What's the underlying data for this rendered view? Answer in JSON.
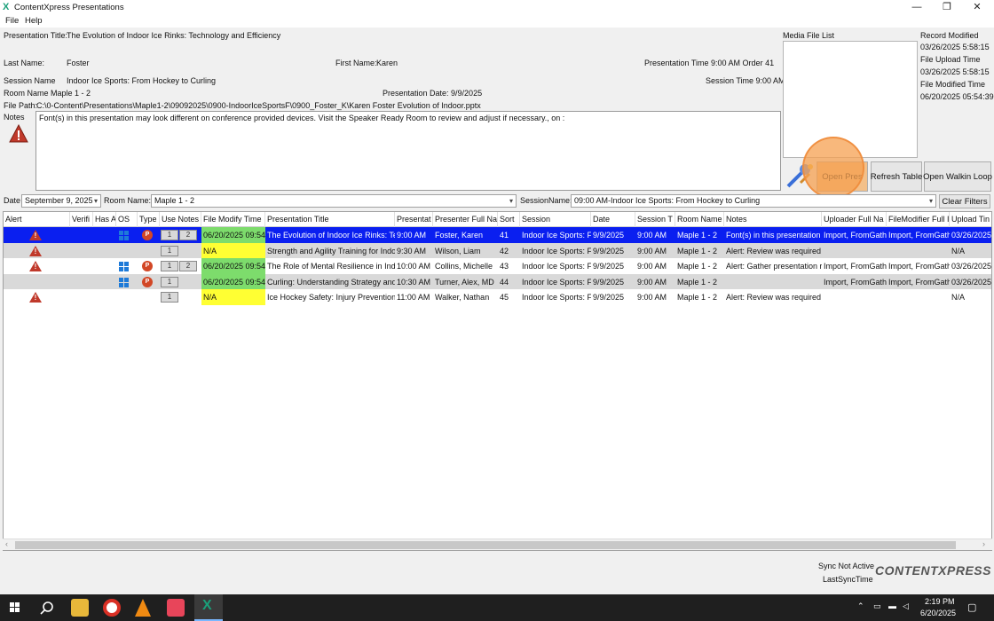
{
  "window": {
    "title": "ContentXpress Presentations",
    "app_icon_glyph": "X",
    "minimize_glyph": "—",
    "restore_glyph": "❐",
    "close_glyph": "✕"
  },
  "menu": [
    "File",
    "Help"
  ],
  "form": {
    "presentation_title_label": "Presentation Title:",
    "presentation_title": "The Evolution of Indoor Ice Rinks: Technology and Efficiency",
    "last_name_label": "Last Name:",
    "last_name": "Foster",
    "first_name_label": "First Name:",
    "first_name": "Karen",
    "presentation_time_text": "Presentation Time 9:00 AM Order 41",
    "session_name_label": "Session Name",
    "session_name": "Indoor Ice Sports: From Hockey to Curling",
    "session_time_text": "Session Time 9:00 AM",
    "room_name_text": "Room Name Maple 1 - 2",
    "presentation_date_text": "Presentation Date: 9/9/2025",
    "file_path_label": "File Path:",
    "file_path": "C:\\0-Content\\Presentations\\Maple1-2\\09092025\\0900-IndoorIceSportsF\\0900_Foster_K\\Karen Foster Evolution of Indoor.pptx",
    "notes_label": "Notes",
    "notes_text": "Font(s) in this presentation may look different on conference provided devices.  Visit the Speaker Ready Room to review and adjust if necessary.,  on :",
    "media_file_list_label": "Media File List",
    "record_modified_label": "Record Modified",
    "record_modified": "03/26/2025 5:58:15",
    "file_upload_time_label": "File Upload Time",
    "file_upload_time": "03/26/2025 5:58:15",
    "file_modified_time_label": "File Modified Time",
    "file_modified_time": "06/20/2025 05:54:39"
  },
  "buttons": {
    "open_pres": "Open Pres",
    "refresh_table": "Refresh Table",
    "open_walkin_loop": "Open Walkin Loop",
    "clear_filters": "Clear Filters"
  },
  "filters": {
    "date_label": "Date",
    "date_value": "September 9, 2025",
    "room_label": "Room Name:",
    "room_value": "Maple 1 - 2",
    "session_label": "SessionName:",
    "session_value": "09:00 AM-Indoor Ice Sports: From Hockey to Curling"
  },
  "table": {
    "columns": [
      "Alert",
      "Verifi",
      "Has A",
      "OS",
      "Type",
      "Use Notes",
      "File Modify Time",
      "Presentation Title",
      "Presentat",
      "Presenter Full Na",
      "Sort",
      "Session",
      "Date",
      "Session T",
      "Room Name",
      "Notes",
      "Uploader Full Na",
      "FileModifier Full I",
      "Upload Tin"
    ],
    "rows": [
      {
        "alert": true,
        "os": true,
        "type": true,
        "notes_count": [
          "1",
          "2"
        ],
        "modify": "06/20/2025 09:54",
        "modify_color": "#7ddc6c",
        "title": "The Evolution of Indoor Ice Rinks: Tec",
        "time": "9:00 AM",
        "presenter": "Foster, Karen",
        "sort": "41",
        "session": "Indoor Ice Sports: Fr",
        "date": "9/9/2025",
        "session_time": "9:00 AM",
        "room": "Maple 1 - 2",
        "notes": "Font(s) in this presentation",
        "uploader": "Import, FromGath",
        "modifier": "Import, FromGath",
        "upload_time": "03/26/2025"
      },
      {
        "alert": true,
        "os": false,
        "type": false,
        "notes_count": [
          "1"
        ],
        "modify": "N/A",
        "modify_color": "#ffff33",
        "title": "Strength and Agility Training for Indo",
        "time": "9:30 AM",
        "presenter": "Wilson, Liam",
        "sort": "42",
        "session": "Indoor Ice Sports: Fr",
        "date": "9/9/2025",
        "session_time": "9:00 AM",
        "room": "Maple 1 - 2",
        "notes": "Alert: Review was required",
        "uploader": "",
        "modifier": "",
        "upload_time": "N/A"
      },
      {
        "alert": true,
        "os": true,
        "type": true,
        "notes_count": [
          "1",
          "2"
        ],
        "modify": "06/20/2025 09:54",
        "modify_color": "#7ddc6c",
        "title": "The Role of Mental Resilience in Indo",
        "time": "10:00 AM",
        "presenter": "Collins, Michelle",
        "sort": "43",
        "session": "Indoor Ice Sports: Fr",
        "date": "9/9/2025",
        "session_time": "9:00 AM",
        "room": "Maple 1 - 2",
        "notes": "Alert: Gather presentation r",
        "uploader": "Import, FromGath",
        "modifier": "Import, FromGath",
        "upload_time": "03/26/2025"
      },
      {
        "alert": false,
        "os": true,
        "type": true,
        "notes_count": [
          "1"
        ],
        "modify": "06/20/2025 09:54",
        "modify_color": "#7ddc6c",
        "title": "Curling: Understanding Strategy and",
        "time": "10:30 AM",
        "presenter": "Turner, Alex, MD",
        "sort": "44",
        "session": "Indoor Ice Sports: Fr",
        "date": "9/9/2025",
        "session_time": "9:00 AM",
        "room": "Maple 1 - 2",
        "notes": "",
        "uploader": "Import, FromGath",
        "modifier": "Import, FromGath",
        "upload_time": "03/26/2025"
      },
      {
        "alert": true,
        "os": false,
        "type": false,
        "notes_count": [
          "1"
        ],
        "modify": "N/A",
        "modify_color": "#ffff33",
        "title": "Ice Hockey Safety: Injury Prevention",
        "time": "11:00 AM",
        "presenter": "Walker, Nathan",
        "sort": "45",
        "session": "Indoor Ice Sports: Fr",
        "date": "9/9/2025",
        "session_time": "9:00 AM",
        "room": "Maple 1 - 2",
        "notes": "Alert: Review was required",
        "uploader": "",
        "modifier": "",
        "upload_time": "N/A"
      }
    ]
  },
  "status": {
    "sync_status": "Sync Not Active",
    "last_sync_label": "LastSyncTime",
    "logo_text": "CONTENTXPRESS"
  },
  "taskbar": {
    "time": "2:19 PM",
    "date": "6/20/2025"
  },
  "icons": {
    "alert": "warning-triangle-icon",
    "windows": "windows-os-icon",
    "powerpoint": "powerpoint-icon"
  },
  "colors": {
    "selected_row": "#0a1ff0",
    "alt_row": "#d9d9d9",
    "alert_red": "#c0392b",
    "date_green": "#7ddc6c",
    "na_yellow": "#ffff33",
    "click_highlight": "#f5a050"
  }
}
